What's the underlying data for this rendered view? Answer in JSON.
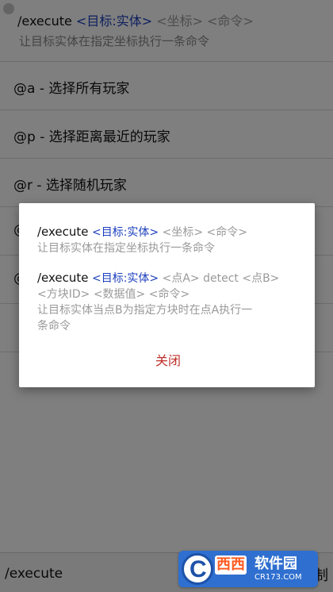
{
  "header": {
    "cmd": "/execute",
    "target": "<目标:实体>",
    "args": "<坐标> <命令>",
    "desc": "让目标实体在指定坐标执行一条命令"
  },
  "selectors": [
    {
      "label": "@a - 选择所有玩家"
    },
    {
      "label": "@p - 选择距离最近的玩家"
    },
    {
      "label": "@r - 选择随机玩家"
    },
    {
      "label": "@"
    },
    {
      "label": "@"
    }
  ],
  "dialog": {
    "entry1": {
      "cmd": "/execute",
      "target": "<目标:实体>",
      "args": "<坐标> <命令>",
      "desc": "让目标实体在指定坐标执行一条命令"
    },
    "entry2": {
      "cmd": "/execute",
      "target": "<目标:实体>",
      "args_line1": "<点A> detect <点B>",
      "args_line2": "<方块ID> <数据值> <命令>",
      "desc_line1": "让目标实体当点B为指定方块时在点A执行一",
      "desc_line2": "条命令"
    },
    "close_label": "关闭"
  },
  "bottom": {
    "input_text": "/execute",
    "right_text": "制"
  },
  "watermark": {
    "logo": "C",
    "brand_a": "西西",
    "brand_b": "软件园",
    "url": "CR173.COM"
  },
  "colors": {
    "accent_blue": "#1b3fbd",
    "close_red": "#c0302b",
    "hint_gray": "#9a9a9a"
  }
}
